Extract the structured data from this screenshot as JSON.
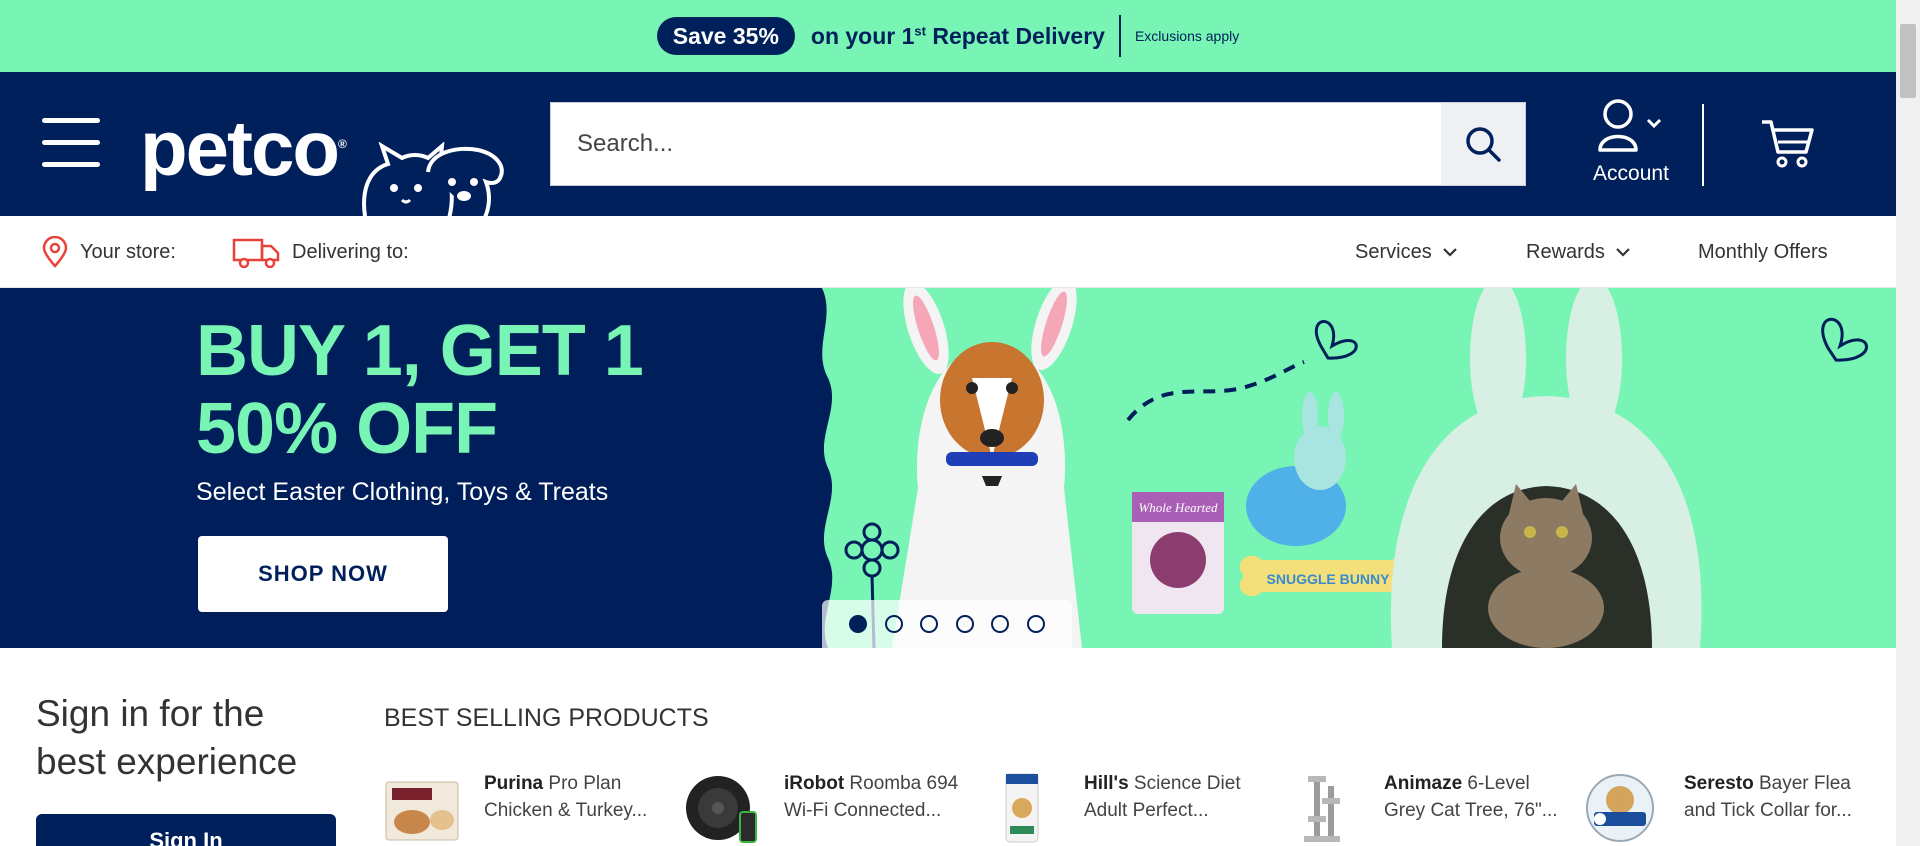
{
  "promo": {
    "pill": "Save 35%",
    "text_before": "on your 1",
    "sup": "st",
    "text_after": " Repeat Delivery",
    "exclusions": "Exclusions apply"
  },
  "header": {
    "logo": "petco",
    "search_placeholder": "Search...",
    "account_label": "Account"
  },
  "subnav": {
    "store_label": "Your store:",
    "delivery_label": "Delivering to:",
    "services": "Services",
    "rewards": "Rewards",
    "monthly_offers": "Monthly Offers"
  },
  "hero": {
    "title_line1": "BUY 1, GET 1",
    "title_line2": "50% OFF",
    "subtitle": "Select Easter Clothing, Toys & Treats",
    "cta": "SHOP NOW",
    "treat_brand": "Whole Hearted",
    "plush_label": "SNUGGLE BUNNY"
  },
  "carousel": {
    "total": 6,
    "active": 1
  },
  "signin": {
    "title_line1": "Sign in for the",
    "title_line2": "best experience",
    "button": "Sign In"
  },
  "best_selling": {
    "title": "BEST SELLING PRODUCTS",
    "products": [
      {
        "brand": "Purina",
        "line1": " Pro Plan",
        "line2": "Chicken & Turkey..."
      },
      {
        "brand": "iRobot",
        "line1": " Roomba 694",
        "line2": "Wi-Fi Connected..."
      },
      {
        "brand": "Hill's",
        "line1": " Science Diet",
        "line2": "Adult Perfect..."
      },
      {
        "brand": "Animaze",
        "line1": " 6-Level",
        "line2": "Grey Cat Tree, 76\"..."
      },
      {
        "brand": "Seresto",
        "line1": " Bayer Flea",
        "line2": "and Tick Collar for..."
      }
    ]
  },
  "colors": {
    "navy": "#00205b",
    "mint": "#78f5b4",
    "accent_red": "#e8433a"
  }
}
